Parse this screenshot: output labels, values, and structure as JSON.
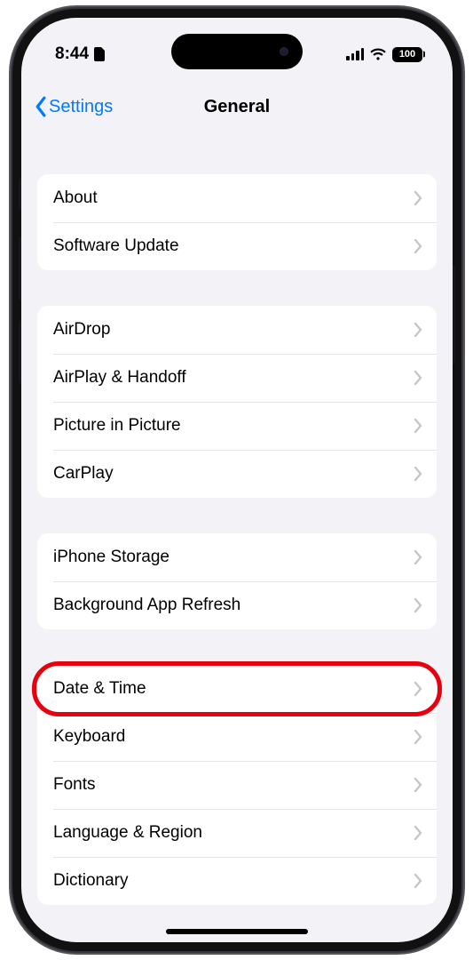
{
  "status": {
    "time": "8:44",
    "battery_level": "100"
  },
  "nav": {
    "back_label": "Settings",
    "title": "General"
  },
  "groups": [
    {
      "rows": [
        {
          "id": "about",
          "label": "About"
        },
        {
          "id": "software-update",
          "label": "Software Update"
        }
      ]
    },
    {
      "rows": [
        {
          "id": "airdrop",
          "label": "AirDrop"
        },
        {
          "id": "airplay-handoff",
          "label": "AirPlay & Handoff"
        },
        {
          "id": "picture-in-picture",
          "label": "Picture in Picture"
        },
        {
          "id": "carplay",
          "label": "CarPlay"
        }
      ]
    },
    {
      "rows": [
        {
          "id": "iphone-storage",
          "label": "iPhone Storage"
        },
        {
          "id": "background-app-refresh",
          "label": "Background App Refresh"
        }
      ]
    },
    {
      "rows": [
        {
          "id": "date-time",
          "label": "Date & Time",
          "highlighted": true
        },
        {
          "id": "keyboard",
          "label": "Keyboard"
        },
        {
          "id": "fonts",
          "label": "Fonts"
        },
        {
          "id": "language-region",
          "label": "Language & Region"
        },
        {
          "id": "dictionary",
          "label": "Dictionary"
        }
      ]
    }
  ],
  "highlight_id": "date-time"
}
